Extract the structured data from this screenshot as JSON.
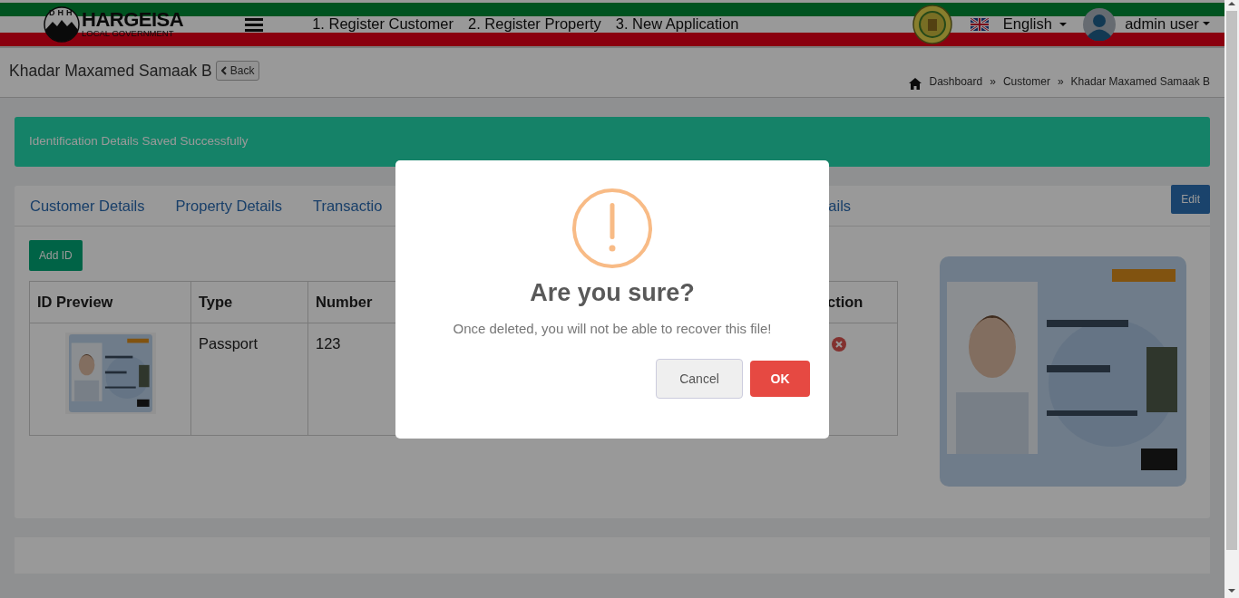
{
  "header": {
    "logo": {
      "initials": "DHH",
      "title": "HARGEISA",
      "subtitle": "LOCAL GOVERNMENT"
    },
    "nav_links": [
      "1. Register Customer",
      "2. Register Property",
      "3. New Application"
    ],
    "language": "English",
    "user": "admin user"
  },
  "page": {
    "title": "Khadar Maxamed Samaak B",
    "back_button": "Back",
    "breadcrumb": [
      {
        "label": "Dashboard"
      },
      {
        "separator": "»",
        "label": "Customer"
      },
      {
        "separator": "»",
        "label": "Khadar Maxamed Samaak B"
      }
    ]
  },
  "alert": "Identification Details Saved Successfully",
  "tabs": [
    "Customer Details",
    "Property Details",
    "Transactio",
    "ails"
  ],
  "edit_button": "Edit",
  "add_button": "Add ID",
  "table": {
    "columns": [
      "ID Preview",
      "Type",
      "Number",
      "ction"
    ],
    "rows": [
      {
        "type": "Passport",
        "number": "123"
      }
    ]
  },
  "modal": {
    "title": "Are you sure?",
    "text": "Once deleted, you will not be able to recover this file!",
    "buttons": [
      {
        "label": "Cancel",
        "kind": "cancel"
      },
      {
        "label": "OK",
        "kind": "confirm"
      }
    ]
  }
}
